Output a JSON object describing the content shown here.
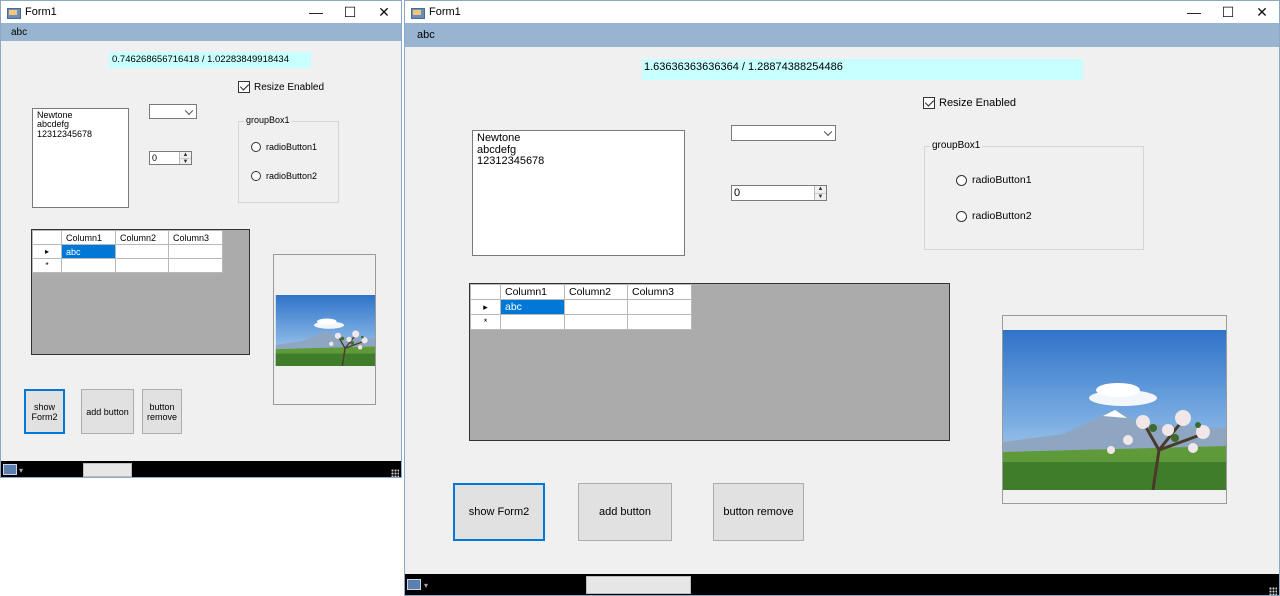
{
  "small_form": {
    "title": "Form1",
    "menu_item": "abc",
    "ratio_label": "0.746268656716418 / 1.02283849918434",
    "resize_checkbox": {
      "label": "Resize Enabled",
      "checked": true
    },
    "listbox_items": [
      "Newtone",
      "abcdefg",
      "12312345678"
    ],
    "combo_value": "",
    "numeric_value": "0",
    "groupbox": {
      "title": "groupBox1",
      "radios": [
        "radioButton1",
        "radioButton2"
      ]
    },
    "grid": {
      "columns": [
        "Column1",
        "Column2",
        "Column3"
      ],
      "rows": [
        [
          "abc",
          "",
          ""
        ],
        [
          "",
          "",
          ""
        ]
      ]
    },
    "buttons": {
      "show": "show\nForm2",
      "add": "add button",
      "remove": "button\nremove"
    }
  },
  "large_form": {
    "title": "Form1",
    "menu_item": "abc",
    "ratio_label": "1.63636363636364 / 1.28874388254486",
    "resize_checkbox": {
      "label": "Resize Enabled",
      "checked": true
    },
    "listbox_items": [
      "Newtone",
      "abcdefg",
      "12312345678"
    ],
    "combo_value": "",
    "numeric_value": "0",
    "groupbox": {
      "title": "groupBox1",
      "radios": [
        "radioButton1",
        "radioButton2"
      ]
    },
    "grid": {
      "columns": [
        "Column1",
        "Column2",
        "Column3"
      ],
      "rows": [
        [
          "abc",
          "",
          ""
        ],
        [
          "",
          "",
          ""
        ]
      ]
    },
    "buttons": {
      "show": "show Form2",
      "add": "add button",
      "remove": "button remove"
    }
  },
  "window_controls": {
    "minimize": "—",
    "maximize": "☐",
    "close": "✕"
  },
  "row_markers": {
    "current": "▸",
    "new": "*"
  },
  "icons": {
    "app": "form-icon",
    "status": "image-icon"
  },
  "colors": {
    "menubar": "#99b4d1",
    "label_bg": "#c8ffff",
    "selection": "#0078d7",
    "grid_bg": "#ababab"
  }
}
